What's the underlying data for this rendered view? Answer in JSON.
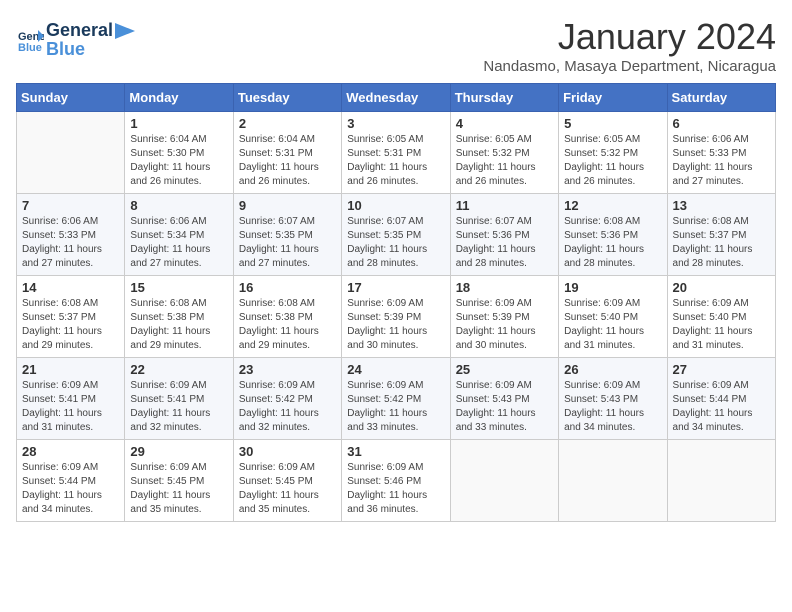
{
  "logo": {
    "line1": "General",
    "line2": "Blue"
  },
  "title": "January 2024",
  "subtitle": "Nandasmo, Masaya Department, Nicaragua",
  "weekdays": [
    "Sunday",
    "Monday",
    "Tuesday",
    "Wednesday",
    "Thursday",
    "Friday",
    "Saturday"
  ],
  "weeks": [
    [
      {
        "day": "",
        "info": ""
      },
      {
        "day": "1",
        "info": "Sunrise: 6:04 AM\nSunset: 5:30 PM\nDaylight: 11 hours\nand 26 minutes."
      },
      {
        "day": "2",
        "info": "Sunrise: 6:04 AM\nSunset: 5:31 PM\nDaylight: 11 hours\nand 26 minutes."
      },
      {
        "day": "3",
        "info": "Sunrise: 6:05 AM\nSunset: 5:31 PM\nDaylight: 11 hours\nand 26 minutes."
      },
      {
        "day": "4",
        "info": "Sunrise: 6:05 AM\nSunset: 5:32 PM\nDaylight: 11 hours\nand 26 minutes."
      },
      {
        "day": "5",
        "info": "Sunrise: 6:05 AM\nSunset: 5:32 PM\nDaylight: 11 hours\nand 26 minutes."
      },
      {
        "day": "6",
        "info": "Sunrise: 6:06 AM\nSunset: 5:33 PM\nDaylight: 11 hours\nand 27 minutes."
      }
    ],
    [
      {
        "day": "7",
        "info": "Sunrise: 6:06 AM\nSunset: 5:33 PM\nDaylight: 11 hours\nand 27 minutes."
      },
      {
        "day": "8",
        "info": "Sunrise: 6:06 AM\nSunset: 5:34 PM\nDaylight: 11 hours\nand 27 minutes."
      },
      {
        "day": "9",
        "info": "Sunrise: 6:07 AM\nSunset: 5:35 PM\nDaylight: 11 hours\nand 27 minutes."
      },
      {
        "day": "10",
        "info": "Sunrise: 6:07 AM\nSunset: 5:35 PM\nDaylight: 11 hours\nand 28 minutes."
      },
      {
        "day": "11",
        "info": "Sunrise: 6:07 AM\nSunset: 5:36 PM\nDaylight: 11 hours\nand 28 minutes."
      },
      {
        "day": "12",
        "info": "Sunrise: 6:08 AM\nSunset: 5:36 PM\nDaylight: 11 hours\nand 28 minutes."
      },
      {
        "day": "13",
        "info": "Sunrise: 6:08 AM\nSunset: 5:37 PM\nDaylight: 11 hours\nand 28 minutes."
      }
    ],
    [
      {
        "day": "14",
        "info": "Sunrise: 6:08 AM\nSunset: 5:37 PM\nDaylight: 11 hours\nand 29 minutes."
      },
      {
        "day": "15",
        "info": "Sunrise: 6:08 AM\nSunset: 5:38 PM\nDaylight: 11 hours\nand 29 minutes."
      },
      {
        "day": "16",
        "info": "Sunrise: 6:08 AM\nSunset: 5:38 PM\nDaylight: 11 hours\nand 29 minutes."
      },
      {
        "day": "17",
        "info": "Sunrise: 6:09 AM\nSunset: 5:39 PM\nDaylight: 11 hours\nand 30 minutes."
      },
      {
        "day": "18",
        "info": "Sunrise: 6:09 AM\nSunset: 5:39 PM\nDaylight: 11 hours\nand 30 minutes."
      },
      {
        "day": "19",
        "info": "Sunrise: 6:09 AM\nSunset: 5:40 PM\nDaylight: 11 hours\nand 31 minutes."
      },
      {
        "day": "20",
        "info": "Sunrise: 6:09 AM\nSunset: 5:40 PM\nDaylight: 11 hours\nand 31 minutes."
      }
    ],
    [
      {
        "day": "21",
        "info": "Sunrise: 6:09 AM\nSunset: 5:41 PM\nDaylight: 11 hours\nand 31 minutes."
      },
      {
        "day": "22",
        "info": "Sunrise: 6:09 AM\nSunset: 5:41 PM\nDaylight: 11 hours\nand 32 minutes."
      },
      {
        "day": "23",
        "info": "Sunrise: 6:09 AM\nSunset: 5:42 PM\nDaylight: 11 hours\nand 32 minutes."
      },
      {
        "day": "24",
        "info": "Sunrise: 6:09 AM\nSunset: 5:42 PM\nDaylight: 11 hours\nand 33 minutes."
      },
      {
        "day": "25",
        "info": "Sunrise: 6:09 AM\nSunset: 5:43 PM\nDaylight: 11 hours\nand 33 minutes."
      },
      {
        "day": "26",
        "info": "Sunrise: 6:09 AM\nSunset: 5:43 PM\nDaylight: 11 hours\nand 34 minutes."
      },
      {
        "day": "27",
        "info": "Sunrise: 6:09 AM\nSunset: 5:44 PM\nDaylight: 11 hours\nand 34 minutes."
      }
    ],
    [
      {
        "day": "28",
        "info": "Sunrise: 6:09 AM\nSunset: 5:44 PM\nDaylight: 11 hours\nand 34 minutes."
      },
      {
        "day": "29",
        "info": "Sunrise: 6:09 AM\nSunset: 5:45 PM\nDaylight: 11 hours\nand 35 minutes."
      },
      {
        "day": "30",
        "info": "Sunrise: 6:09 AM\nSunset: 5:45 PM\nDaylight: 11 hours\nand 35 minutes."
      },
      {
        "day": "31",
        "info": "Sunrise: 6:09 AM\nSunset: 5:46 PM\nDaylight: 11 hours\nand 36 minutes."
      },
      {
        "day": "",
        "info": ""
      },
      {
        "day": "",
        "info": ""
      },
      {
        "day": "",
        "info": ""
      }
    ]
  ]
}
